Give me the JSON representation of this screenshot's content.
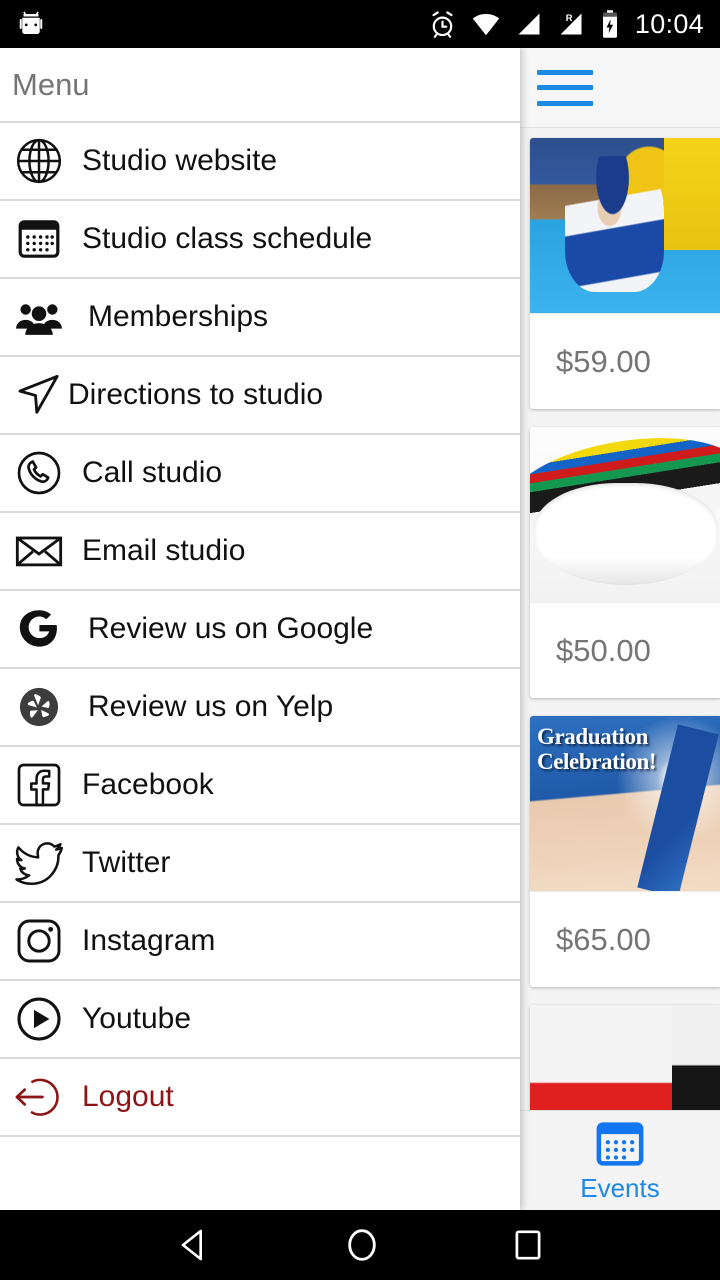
{
  "status_bar": {
    "clock": "10:04",
    "icons": [
      "android-robot-icon",
      "alarm-icon",
      "wifi-icon",
      "signal-icon",
      "roaming-signal-icon",
      "battery-charging-icon"
    ],
    "roaming_letter": "R",
    "background": "#000000",
    "foreground": "#ffffff"
  },
  "drawer": {
    "title": "Menu",
    "items": [
      {
        "label": "Studio website",
        "icon": "globe-icon",
        "color": "#111111"
      },
      {
        "label": "Studio class schedule",
        "icon": "calendar-icon",
        "color": "#111111"
      },
      {
        "label": "Memberships",
        "icon": "people-icon",
        "color": "#111111"
      },
      {
        "label": "Directions to studio",
        "icon": "navigate-icon",
        "color": "#111111"
      },
      {
        "label": "Call studio",
        "icon": "phone-icon",
        "color": "#111111"
      },
      {
        "label": "Email studio",
        "icon": "envelope-icon",
        "color": "#111111"
      },
      {
        "label": "Review us on Google",
        "icon": "google-icon",
        "color": "#111111"
      },
      {
        "label": "Review us on Yelp",
        "icon": "yelp-icon",
        "color": "#111111"
      },
      {
        "label": "Facebook",
        "icon": "facebook-icon",
        "color": "#111111"
      },
      {
        "label": "Twitter",
        "icon": "twitter-icon",
        "color": "#111111"
      },
      {
        "label": "Instagram",
        "icon": "instagram-icon",
        "color": "#111111"
      },
      {
        "label": "Youtube",
        "icon": "youtube-icon",
        "color": "#111111"
      },
      {
        "label": "Logout",
        "icon": "logout-icon",
        "color": "#8c1616"
      }
    ]
  },
  "content": {
    "menu_button": "hamburger-menu-icon",
    "accent_color": "#1e88e5",
    "cards": [
      {
        "price": "$59.00",
        "image": "taekwondo-sparring-photo",
        "caption": ""
      },
      {
        "price": "$50.00",
        "image": "martial-arts-belts-photo",
        "caption": ""
      },
      {
        "price": "$65.00",
        "image": "graduation-celebration-photo",
        "caption": "Graduation\nCelebration!"
      },
      {
        "price": "",
        "image": "red-belt-photo",
        "caption": ""
      }
    ],
    "graduation_line1": "Graduation",
    "graduation_line2": "Celebration!"
  },
  "tab_bar": {
    "tabs": [
      {
        "label": "Events",
        "icon": "calendar-icon",
        "active": true,
        "color": "#1e88e5"
      }
    ]
  },
  "nav_bar": {
    "buttons": [
      {
        "name": "back-button",
        "icon": "triangle-left-icon"
      },
      {
        "name": "home-button",
        "icon": "circle-icon"
      },
      {
        "name": "recents-button",
        "icon": "square-icon"
      }
    ]
  }
}
